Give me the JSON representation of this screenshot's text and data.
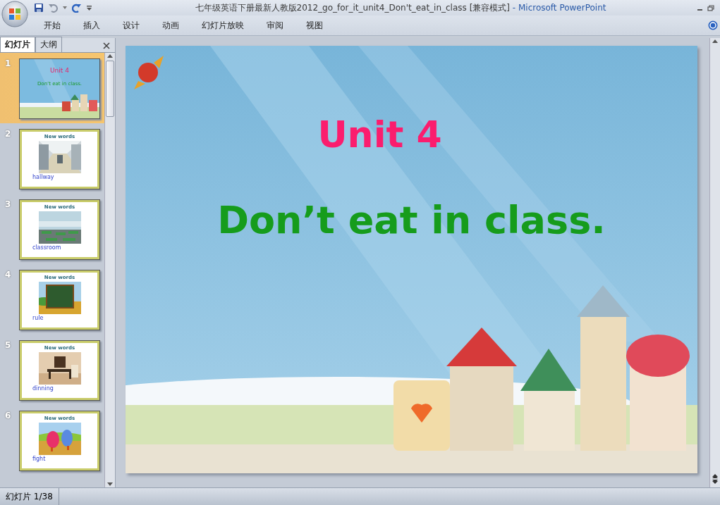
{
  "window": {
    "title": "七年级英语下册最新人教版2012_go_for_it_unit4_Don't_eat_in_class [兼容模式]",
    "app_name": " - Microsoft PowerPoint"
  },
  "ribbon_tabs": [
    "开始",
    "插入",
    "设计",
    "动画",
    "幻灯片放映",
    "审阅",
    "视图"
  ],
  "panel_tabs": [
    {
      "label": "幻灯片",
      "selected": true
    },
    {
      "label": "大纲",
      "selected": false
    }
  ],
  "slides": [
    {
      "number": "1",
      "selected": true,
      "kind": "title",
      "title": "Unit 4",
      "subtitle": "Don’t eat in class."
    },
    {
      "number": "2",
      "selected": false,
      "kind": "words",
      "heading": "New words",
      "word": "hallway"
    },
    {
      "number": "3",
      "selected": false,
      "kind": "words",
      "heading": "New words",
      "word": "classroom"
    },
    {
      "number": "4",
      "selected": false,
      "kind": "words",
      "heading": "New words",
      "word": "rule"
    },
    {
      "number": "5",
      "selected": false,
      "kind": "words",
      "heading": "New words",
      "word": "dinning"
    },
    {
      "number": "6",
      "selected": false,
      "kind": "words",
      "heading": "New words",
      "word": "fight"
    }
  ],
  "current_slide": {
    "title": "Unit 4",
    "subtitle": "Don’t eat in class."
  },
  "status_bar": {
    "slide_counter": "幻灯片 1/38"
  }
}
